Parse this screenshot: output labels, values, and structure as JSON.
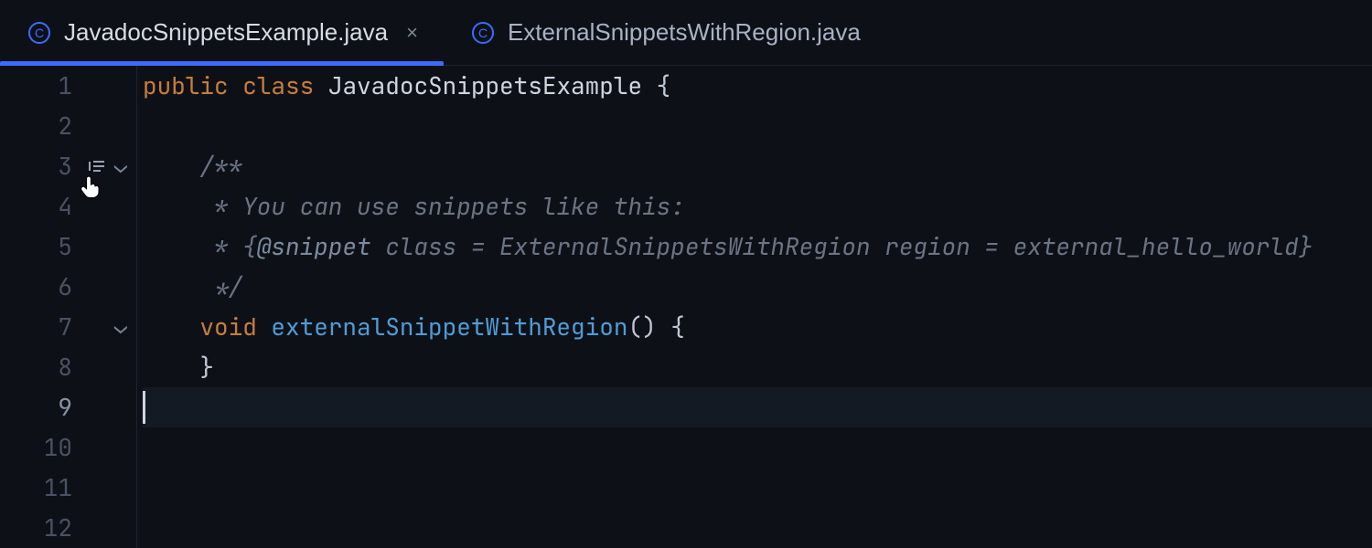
{
  "icons": {
    "file_glyph": "C",
    "close_glyph": "×",
    "chevron_down": "⌄"
  },
  "tabs": [
    {
      "label": "JavadocSnippetsExample.java",
      "active": true,
      "closeable": true
    },
    {
      "label": "ExternalSnippetsWithRegion.java",
      "active": false,
      "closeable": false
    }
  ],
  "editor": {
    "cursor_line": 9,
    "gutter": [
      {
        "n": 1
      },
      {
        "n": 2
      },
      {
        "n": 3,
        "render_doc": true,
        "fold": true,
        "hand_cursor": true
      },
      {
        "n": 4
      },
      {
        "n": 5
      },
      {
        "n": 6
      },
      {
        "n": 7,
        "fold": true
      },
      {
        "n": 8
      },
      {
        "n": 9,
        "caret": true
      },
      {
        "n": 10
      },
      {
        "n": 11
      },
      {
        "n": 12
      }
    ],
    "lines": [
      {
        "kind": "code",
        "indent": 0,
        "tokens": [
          {
            "c": "kw",
            "t": "public"
          },
          {
            "c": "plain",
            "t": " "
          },
          {
            "c": "kw",
            "t": "class"
          },
          {
            "c": "plain",
            "t": " "
          },
          {
            "c": "type",
            "t": "JavadocSnippetsExample"
          },
          {
            "c": "plain",
            "t": " "
          },
          {
            "c": "brace",
            "t": "{"
          }
        ]
      },
      {
        "kind": "blank"
      },
      {
        "kind": "doc",
        "indent": 1,
        "text": "/**"
      },
      {
        "kind": "doc",
        "indent": 1,
        "text": " * You can use snippets like this:"
      },
      {
        "kind": "doc",
        "indent": 1,
        "tokens": [
          {
            "c": "doc",
            "t": " * {"
          },
          {
            "c": "doctag",
            "t": "@snippet"
          },
          {
            "c": "doc",
            "t": " class = ExternalSnippetsWithRegion region = external_hello_world}"
          }
        ]
      },
      {
        "kind": "doc",
        "indent": 1,
        "text": " */"
      },
      {
        "kind": "code",
        "indent": 1,
        "tokens": [
          {
            "c": "kw",
            "t": "void"
          },
          {
            "c": "plain",
            "t": " "
          },
          {
            "c": "fn",
            "t": "externalSnippetWithRegion"
          },
          {
            "c": "plain",
            "t": "() "
          },
          {
            "c": "brace",
            "t": "{"
          }
        ]
      },
      {
        "kind": "code",
        "indent": 1,
        "tokens": [
          {
            "c": "brace",
            "t": "}"
          }
        ]
      },
      {
        "kind": "caret"
      },
      {
        "kind": "blank"
      },
      {
        "kind": "blank"
      },
      {
        "kind": "blank"
      }
    ]
  },
  "indent_unit": "    "
}
